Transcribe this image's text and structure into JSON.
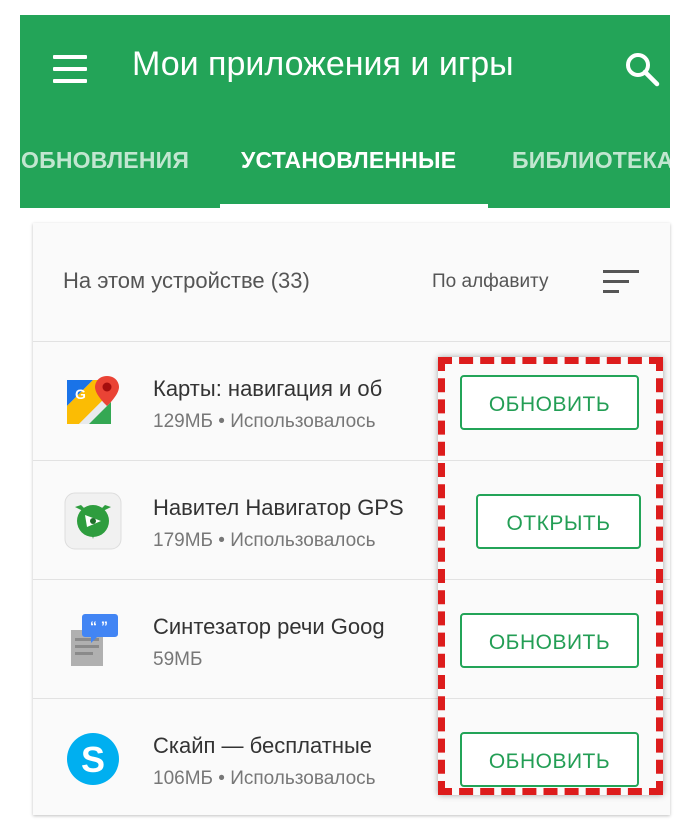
{
  "header": {
    "title": "Мои приложения и игры",
    "background": "#23a458"
  },
  "tabs": [
    {
      "label": "ОБНОВЛЕНИЯ",
      "active": false
    },
    {
      "label": "УСТАНОВЛЕННЫЕ",
      "active": true
    },
    {
      "label": "БИБЛИОТЕКА",
      "active": false
    }
  ],
  "list": {
    "device_label": "На этом устройстве (33)",
    "sort_label": "По алфавиту",
    "apps": [
      {
        "name": "Карты: навигация и об",
        "meta": "129МБ • Использовалось",
        "action": "ОБНОВИТЬ",
        "icon": "google-maps-icon"
      },
      {
        "name": "Навител Навигатор GPS",
        "meta": "179МБ • Использовалось",
        "action": "ОТКРЫТЬ",
        "icon": "navitel-icon"
      },
      {
        "name": "Синтезатор речи Goog",
        "meta": "59МБ",
        "action": "ОБНОВИТЬ",
        "icon": "tts-icon"
      },
      {
        "name": "Скайп — бесплатные",
        "meta": "106МБ • Использовалось",
        "action": "ОБНОВИТЬ",
        "icon": "skype-icon"
      }
    ]
  },
  "colors": {
    "accent": "#23a458",
    "highlight": "#dd1c1c"
  }
}
